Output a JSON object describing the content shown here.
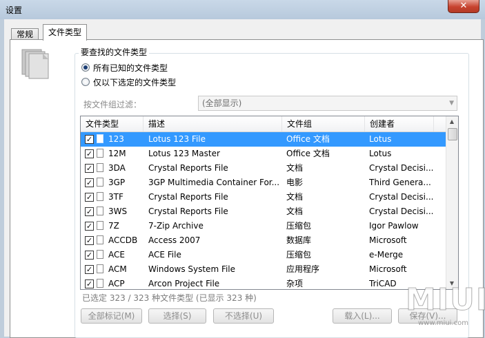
{
  "window": {
    "title": "设置",
    "close_glyph": "✕"
  },
  "tabs": [
    {
      "label": "常规"
    },
    {
      "label": "文件类型"
    }
  ],
  "group": {
    "title": "要查找的文件类型"
  },
  "radios": [
    {
      "label": "所有已知的文件类型",
      "checked": true
    },
    {
      "label": "仅以下选定的文件类型",
      "checked": false
    }
  ],
  "filter": {
    "label": "按文件组过滤：",
    "value": "(全部显示)"
  },
  "list": {
    "columns": [
      "文件类型",
      "描述",
      "文件组",
      "创建者"
    ],
    "rows": [
      {
        "type": "123",
        "desc": "Lotus 123 File",
        "group": "Office 文档",
        "creator": "Lotus",
        "checked": true,
        "selected": true
      },
      {
        "type": "12M",
        "desc": "Lotus 123 Master",
        "group": "Office 文档",
        "creator": "Lotus",
        "checked": true,
        "selected": false
      },
      {
        "type": "3DA",
        "desc": "Crystal Reports File",
        "group": "文档",
        "creator": "Crystal Decisi...",
        "checked": true,
        "selected": false
      },
      {
        "type": "3GP",
        "desc": "3GP Multimedia Container For...",
        "group": "电影",
        "creator": "Third Genera...",
        "checked": true,
        "selected": false
      },
      {
        "type": "3TF",
        "desc": "Crystal Reports File",
        "group": "文档",
        "creator": "Crystal Decisi...",
        "checked": true,
        "selected": false
      },
      {
        "type": "3WS",
        "desc": "Crystal Reports File",
        "group": "文档",
        "creator": "Crystal Decisi...",
        "checked": true,
        "selected": false
      },
      {
        "type": "7Z",
        "desc": "7-Zip Archive",
        "group": "压缩包",
        "creator": "Igor Pawlow",
        "checked": true,
        "selected": false
      },
      {
        "type": "ACCDB",
        "desc": "Access 2007",
        "group": "数据库",
        "creator": "Microsoft",
        "checked": true,
        "selected": false
      },
      {
        "type": "ACE",
        "desc": "ACE File",
        "group": "压缩包",
        "creator": "e-Merge",
        "checked": true,
        "selected": false
      },
      {
        "type": "ACM",
        "desc": "Windows System File",
        "group": "应用程序",
        "creator": "Microsoft",
        "checked": true,
        "selected": false
      },
      {
        "type": "ACP",
        "desc": "Arcon Project File",
        "group": "杂项",
        "creator": "TriCAD",
        "checked": true,
        "selected": false
      }
    ]
  },
  "status": "已选定 323 / 323 种文件类型 (已显示 323 种)",
  "buttons": {
    "mark_all": "全部标记(M)",
    "select": "选择(S)",
    "deselect": "不选择(U)",
    "load": "载入(L)...",
    "save": "保存(V)..."
  },
  "watermark": {
    "text": "MIUI",
    "url": "www.miui.com"
  },
  "colors": {
    "selection": "#3399ff",
    "titlebar": "#bfcddb",
    "close": "#c7432f"
  }
}
